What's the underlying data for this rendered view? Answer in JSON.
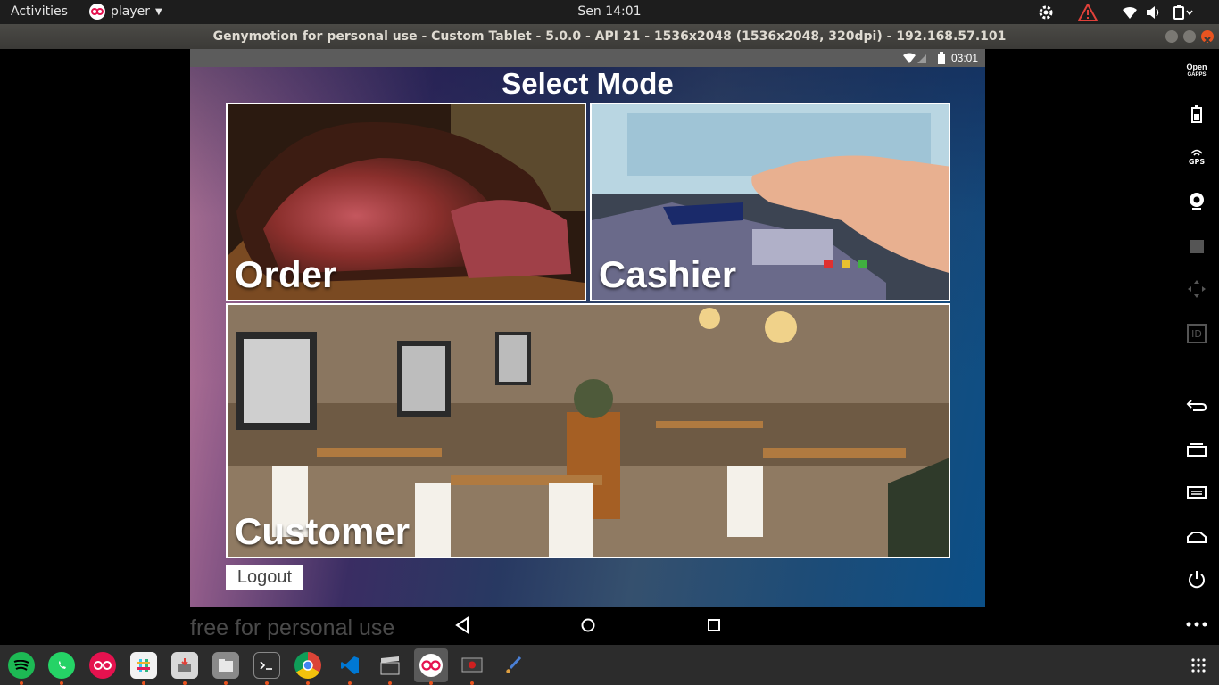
{
  "topbar": {
    "activities": "Activities",
    "app_name": "player",
    "clock": "Sen 14:01"
  },
  "window": {
    "title": "Genymotion for personal use - Custom Tablet - 5.0.0 - API 21 - 1536x2048 (1536x2048, 320dpi) - 192.168.57.101"
  },
  "android": {
    "status_time": "03:01",
    "title": "Select Mode",
    "tiles": {
      "order": "Order",
      "cashier": "Cashier",
      "customer": "Customer"
    },
    "logout": "Logout"
  },
  "watermark": "free for personal use",
  "sidebar": {
    "opengapps_line1": "Open",
    "opengapps_line2": "GAPPS",
    "gps": "GPS",
    "id": "ID"
  },
  "colors": {
    "accent": "#e95420",
    "tile_border": "#ffffff"
  }
}
